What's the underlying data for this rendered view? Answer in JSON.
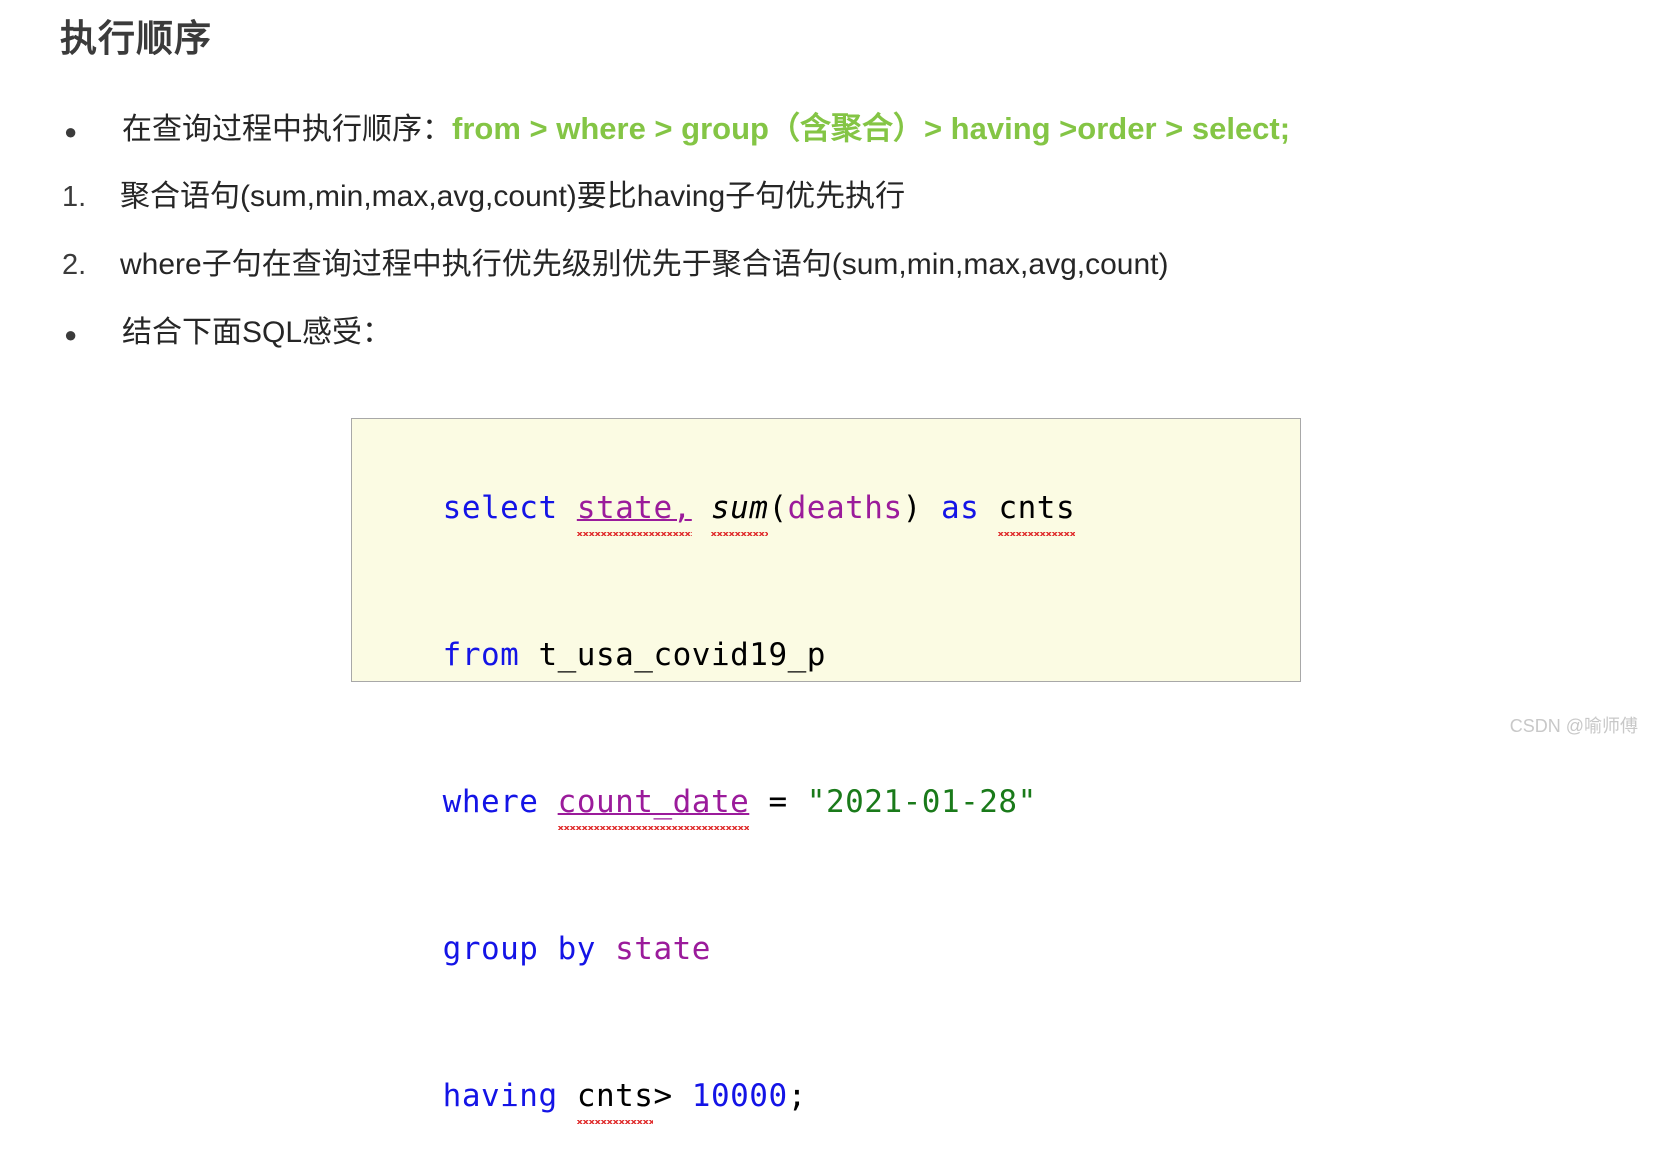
{
  "slide": {
    "title": "执行顺序",
    "watermark": "CSDN @喻师傅"
  },
  "list": {
    "items": [
      {
        "marker": "●",
        "marker_type": "bullet",
        "text_plain": "在查询过程中执行顺序：",
        "text_highlight": "from > where > group（含聚合）> having >order > select;"
      },
      {
        "marker": "1.",
        "marker_type": "number",
        "text_plain": "聚合语句(sum,min,max,avg,count)要比having子句优先执行",
        "text_highlight": ""
      },
      {
        "marker": "2.",
        "marker_type": "number",
        "text_plain": "where子句在查询过程中执行优先级别优先于聚合语句(sum,min,max,avg,count)",
        "text_highlight": ""
      },
      {
        "marker": "●",
        "marker_type": "bullet",
        "text_plain": "结合下面SQL感受：",
        "text_highlight": ""
      }
    ]
  },
  "code": {
    "language": "sql",
    "full_text": "select state, sum(deaths) as cnts\nfrom t_usa_covid19_p\nwhere count_date = \"2021-01-28\"\ngroup by state\nhaving cnts> 10000;",
    "lines": [
      {
        "tokens": [
          {
            "t": "select",
            "k": "kw"
          },
          {
            "t": " ",
            "k": "plain"
          },
          {
            "t": "state,",
            "k": "ident-underline-squiggly"
          },
          {
            "t": " ",
            "k": "plain"
          },
          {
            "t": "sum",
            "k": "fn-italic-squiggly"
          },
          {
            "t": "(",
            "k": "plain"
          },
          {
            "t": "deaths",
            "k": "ident"
          },
          {
            "t": ")",
            "k": "plain"
          },
          {
            "t": " ",
            "k": "plain"
          },
          {
            "t": "as",
            "k": "kw"
          },
          {
            "t": " ",
            "k": "plain"
          },
          {
            "t": "cnts",
            "k": "plain-squiggly"
          }
        ]
      },
      {
        "tokens": [
          {
            "t": "from",
            "k": "kw"
          },
          {
            "t": " ",
            "k": "plain"
          },
          {
            "t": "t_usa_covid19_p",
            "k": "plain"
          }
        ]
      },
      {
        "tokens": [
          {
            "t": "where",
            "k": "kw"
          },
          {
            "t": " ",
            "k": "plain"
          },
          {
            "t": "count_date",
            "k": "ident-underline-squiggly"
          },
          {
            "t": " = ",
            "k": "plain"
          },
          {
            "t": "\"2021-01-28\"",
            "k": "str"
          }
        ]
      },
      {
        "tokens": [
          {
            "t": "group by",
            "k": "kw"
          },
          {
            "t": " ",
            "k": "plain"
          },
          {
            "t": "state",
            "k": "ident"
          }
        ]
      },
      {
        "tokens": [
          {
            "t": "having",
            "k": "kw"
          },
          {
            "t": " ",
            "k": "plain"
          },
          {
            "t": "cnts",
            "k": "plain-squiggly"
          },
          {
            "t": "> ",
            "k": "plain"
          },
          {
            "t": "10000",
            "k": "num"
          },
          {
            "t": ";",
            "k": "plain"
          }
        ]
      }
    ]
  },
  "colors": {
    "title": "#3b3b3b",
    "body_text": "#262626",
    "highlight_green": "#84c545",
    "code_bg": "#fbfbe3",
    "code_border": "#a8a8a8",
    "code_keyword": "#1414e6",
    "code_identifier": "#9b1b9b",
    "code_string": "#1a7a1a",
    "code_number": "#1414e6",
    "squiggle_red": "#e03030",
    "watermark": "#c8c8c8"
  }
}
